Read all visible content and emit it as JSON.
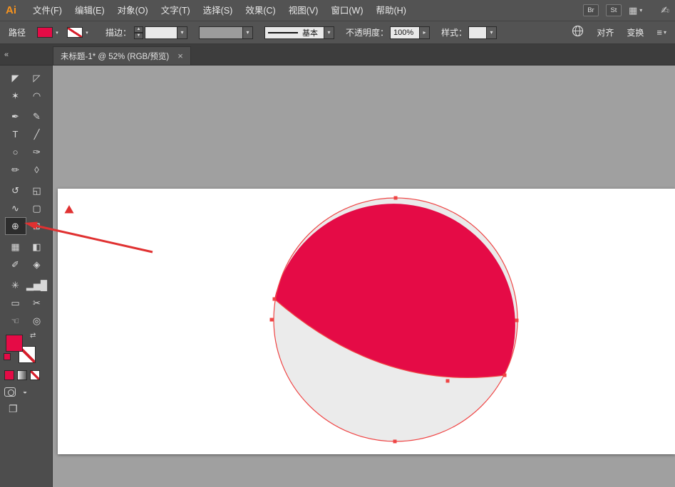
{
  "colors": {
    "accent": "#e50b46",
    "lower_gray": "#ebebeb",
    "selection": "#ef4444",
    "annotation": "#e03131"
  },
  "menubar": {
    "logo": "Ai",
    "items": [
      {
        "id": "file",
        "label": "文件(F)"
      },
      {
        "id": "edit",
        "label": "编辑(E)"
      },
      {
        "id": "object",
        "label": "对象(O)"
      },
      {
        "id": "type",
        "label": "文字(T)"
      },
      {
        "id": "select",
        "label": "选择(S)"
      },
      {
        "id": "effect",
        "label": "效果(C)"
      },
      {
        "id": "view",
        "label": "视图(V)"
      },
      {
        "id": "window",
        "label": "窗口(W)"
      },
      {
        "id": "help",
        "label": "帮助(H)"
      }
    ],
    "bridge_label": "Br",
    "stock_label": "St",
    "workspace_grid_icon": "▦",
    "workspace_caret": "▾",
    "stylus_icon": "✍"
  },
  "controlbar": {
    "context_label": "路径",
    "caret": "▾",
    "stepper_up": "▲",
    "stepper_down": "▼",
    "stroke_label": "描边：",
    "brush_value": "基本",
    "opacity_label": "不透明度：",
    "opacity_value": "100%",
    "opacity_caret": "▸",
    "style_label": "样式：",
    "align_label": "对齐",
    "transform_label": "变换",
    "panel_menu_icon": "≡"
  },
  "tabstrip": {
    "collapse_icon": "«",
    "tab_title": "未标题-1* @ 52% (RGB/预览)",
    "close_icon": "×"
  },
  "toolbar": {
    "active": "shape-builder-tool",
    "swap_icon": "⇄",
    "screen_mode_icon": "❐",
    "draw_small_icon": "◒",
    "tools": [
      {
        "name": "selection-tool",
        "glyph": "◤"
      },
      {
        "name": "direct-selection-tool",
        "glyph": "◸"
      },
      {
        "name": "magic-wand-tool",
        "glyph": "✶"
      },
      {
        "name": "lasso-tool",
        "glyph": "◠"
      },
      {
        "name": "pen-tool",
        "glyph": "✒"
      },
      {
        "name": "pencil-tool",
        "glyph": "✎"
      },
      {
        "name": "type-tool",
        "glyph": "T"
      },
      {
        "name": "line-segment-tool",
        "glyph": "╱"
      },
      {
        "name": "ellipse-tool",
        "glyph": "○"
      },
      {
        "name": "paintbrush-tool",
        "glyph": "✑"
      },
      {
        "name": "blob-brush-tool",
        "glyph": "✏"
      },
      {
        "name": "eraser-tool",
        "glyph": "◊"
      },
      {
        "name": "rotate-tool",
        "glyph": "↺"
      },
      {
        "name": "scale-tool",
        "glyph": "◱"
      },
      {
        "name": "width-tool",
        "glyph": "∿"
      },
      {
        "name": "free-transform-tool",
        "glyph": "▢"
      },
      {
        "name": "shape-builder-tool",
        "glyph": "⊕"
      },
      {
        "name": "perspective-grid-tool",
        "glyph": "⊞"
      },
      {
        "name": "mesh-tool",
        "glyph": "▦"
      },
      {
        "name": "gradient-tool",
        "glyph": "◧"
      },
      {
        "name": "eyedropper-tool",
        "glyph": "✐"
      },
      {
        "name": "blend-tool",
        "glyph": "◈"
      },
      {
        "name": "symbol-sprayer-tool",
        "glyph": "✳"
      },
      {
        "name": "column-graph-tool",
        "glyph": "▂▅█"
      },
      {
        "name": "artboard-tool",
        "glyph": "▭"
      },
      {
        "name": "slice-tool",
        "glyph": "✂"
      },
      {
        "name": "hand-tool",
        "glyph": "☜"
      },
      {
        "name": "zoom-tool",
        "glyph": "◎"
      }
    ]
  }
}
